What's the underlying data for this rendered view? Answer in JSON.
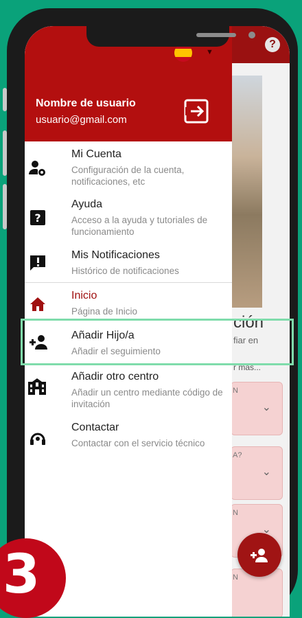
{
  "drawer": {
    "user_name": "Nombre de usuario",
    "user_email": "usuario@gmail.com",
    "language_flag": "spain-flag-icon",
    "items": [
      {
        "icon": "account-settings-icon",
        "title": "Mi Cuenta",
        "subtitle": "Configuración de la cuenta, notificaciones, etc"
      },
      {
        "icon": "help-icon",
        "title": "Ayuda",
        "subtitle": "Acceso a la ayuda y tutoriales de funcionamiento"
      },
      {
        "icon": "notification-icon",
        "title": "Mis Notificaciones",
        "subtitle": "Histórico de notificaciones"
      },
      {
        "icon": "home-icon",
        "title": "Inicio",
        "subtitle": "Página de Inicio",
        "active": true
      },
      {
        "icon": "add-child-icon",
        "title": "Añadir Hijo/a",
        "subtitle": "Añadir el seguimiento",
        "highlighted": true
      },
      {
        "icon": "school-icon",
        "title": "Añadir otro centro",
        "subtitle": "Añadir un centro mediante código de invitación"
      },
      {
        "icon": "support-icon",
        "title": "Contactar",
        "subtitle": "Contactar con el servicio técnico"
      }
    ]
  },
  "background": {
    "title_fragment": "ción",
    "subtitle_fragment": "fiar en",
    "more_fragment": "r más...",
    "cards": [
      {
        "text": "N"
      },
      {
        "text": "A?"
      },
      {
        "text": "N"
      },
      {
        "text": "N"
      }
    ]
  },
  "step_number": "3",
  "colors": {
    "background": "#0aa27a",
    "header_red": "#b30f0f",
    "active_red": "#a01010",
    "highlight_border": "#7fdcab",
    "step_badge": "#c1081a"
  }
}
